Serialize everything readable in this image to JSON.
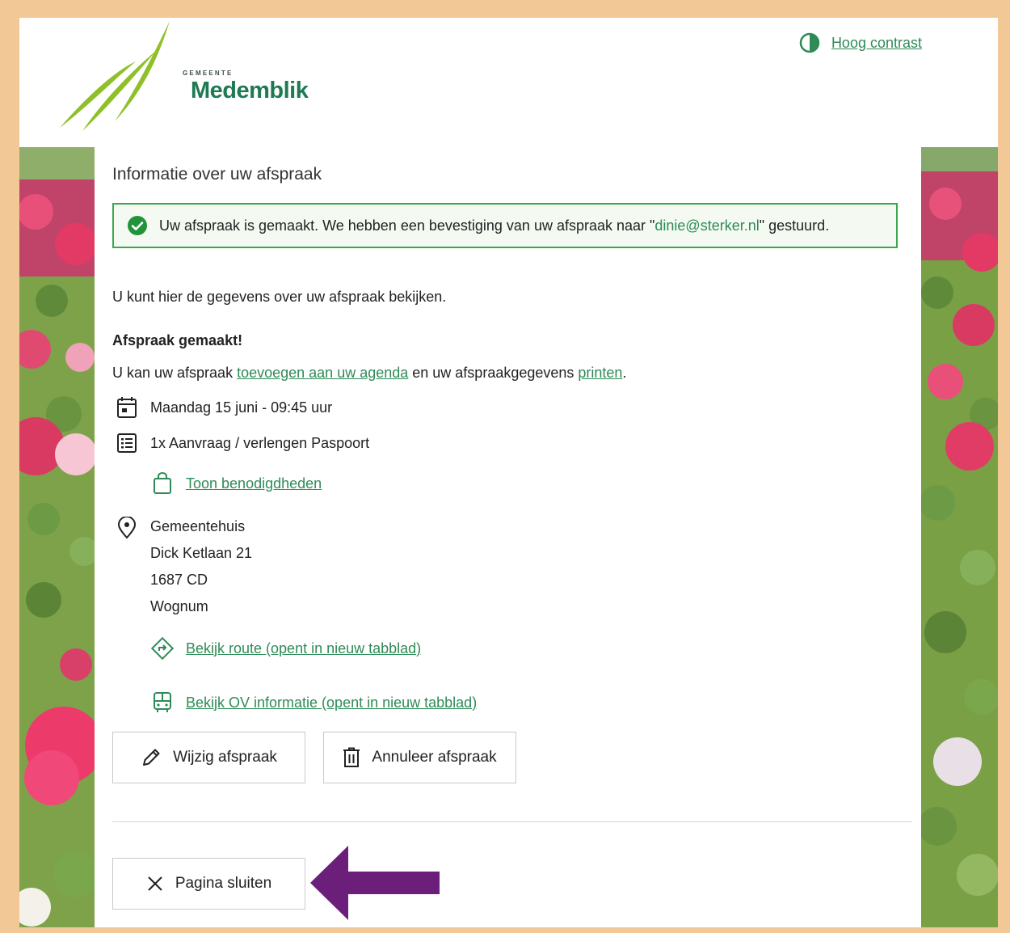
{
  "header": {
    "logo_small": "GEMEENTE",
    "logo_name": "Medemblik",
    "contrast_link": "Hoog contrast"
  },
  "page": {
    "title": "Informatie over uw afspraak",
    "alert": {
      "before": "Uw afspraak is gemaakt. We hebben een bevestiging van uw afspraak naar \"",
      "email": "dinie@sterker.nl",
      "after": "\" gestuurd."
    },
    "intro": "U kunt hier de gegevens over uw afspraak bekijken.",
    "subheading": "Afspraak gemaakt!",
    "agenda_line": {
      "before": "U kan uw afspraak ",
      "agenda_link": "toevoegen aan uw agenda",
      "middle": " en uw afspraakgegevens ",
      "print_link": "printen",
      "after": "."
    },
    "datetime": "Maandag 15 juni - 09:45 uur",
    "product": "1x Aanvraag / verlengen Paspoort",
    "requirements_link": "Toon benodigdheden",
    "location": {
      "name": "Gemeentehuis",
      "street": "Dick Ketlaan 21",
      "postcode": "1687 CD",
      "city": "Wognum"
    },
    "route_link": "Bekijk route (opent in nieuw tabblad)",
    "ov_link": "Bekijk OV informatie (opent in nieuw tabblad)",
    "buttons": {
      "edit": "Wijzig afspraak",
      "cancel": "Annuleer afspraak",
      "close": "Pagina sluiten"
    }
  },
  "colors": {
    "accent": "#2e8b57",
    "alert_border": "#3aa84a",
    "frame": "#f2c896",
    "annotation_arrow": "#6b1f7a"
  }
}
